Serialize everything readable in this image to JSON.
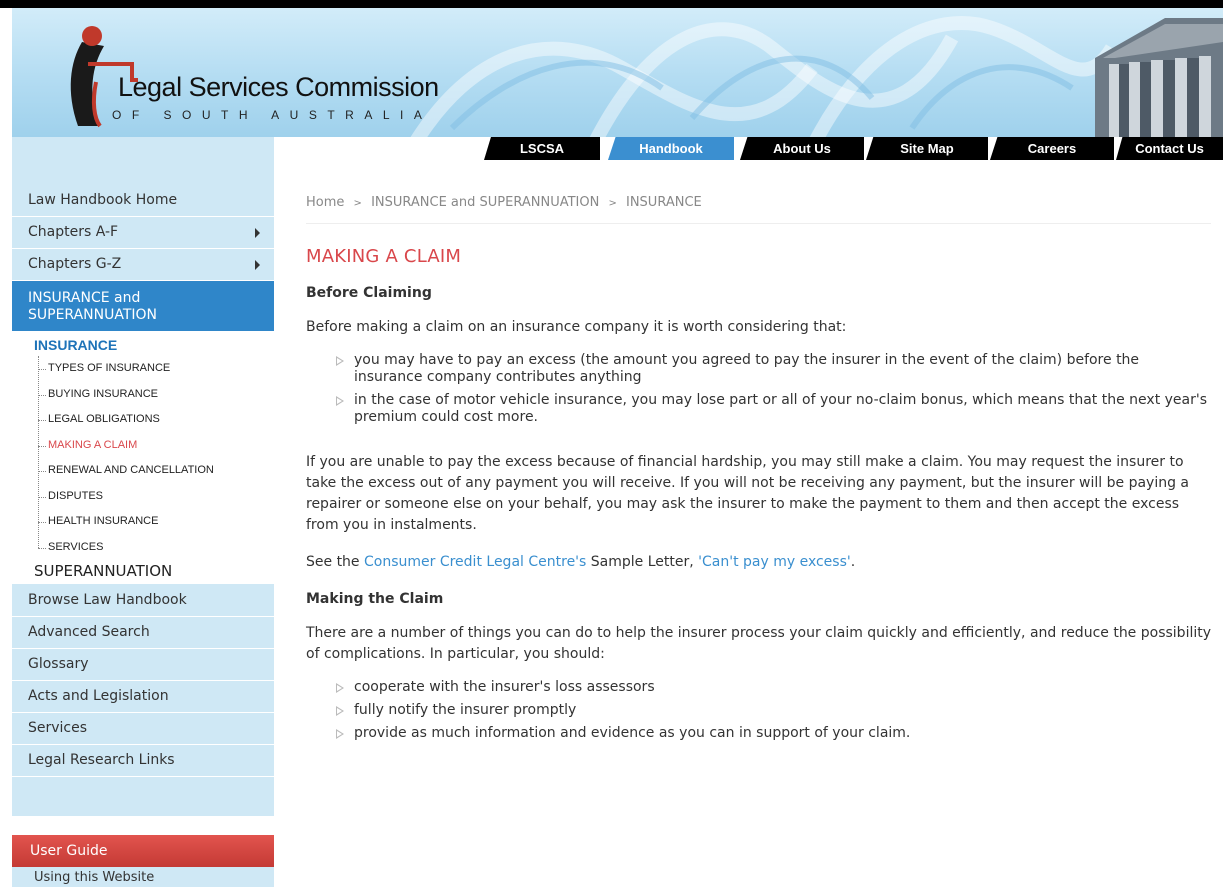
{
  "brand": {
    "title": "Legal Services Commission",
    "subtitle": "OF SOUTH AUSTRALIA"
  },
  "topnav": {
    "tabs": [
      {
        "label": "LSCSA",
        "active": false
      },
      {
        "label": "Handbook",
        "active": true
      },
      {
        "label": "About Us",
        "active": false
      },
      {
        "label": "Site Map",
        "active": false
      },
      {
        "label": "Careers",
        "active": false
      },
      {
        "label": "Contact Us",
        "active": false
      }
    ]
  },
  "sidebar": {
    "items_top": [
      "Law Handbook Home",
      "Chapters A-F",
      "Chapters G-Z"
    ],
    "active_section": "INSURANCE and SUPERANNUATION",
    "sub_heading": "INSURANCE",
    "sub_items": [
      "TYPES OF INSURANCE",
      "BUYING INSURANCE",
      "LEGAL OBLIGATIONS",
      "MAKING A CLAIM",
      "RENEWAL AND CANCELLATION",
      "DISPUTES",
      "HEALTH INSURANCE",
      "SERVICES"
    ],
    "current_sub_item": "MAKING A CLAIM",
    "superannuation": "SUPERANNUATION",
    "items_bottom": [
      "Browse Law Handbook",
      "Advanced Search",
      "Glossary",
      "Acts and Legislation",
      "Services",
      "Legal Research Links"
    ],
    "user_guide": "User Guide",
    "user_guide_item": "Using this Website"
  },
  "breadcrumb": {
    "home": "Home",
    "level1": "INSURANCE and SUPERANNUATION",
    "level2": "INSURANCE",
    "separator": ">"
  },
  "content": {
    "title": "MAKING A CLAIM",
    "section1_heading": "Before Claiming",
    "section1_intro": "Before making a claim on an insurance company it is worth considering that:",
    "section1_bullets": [
      "you may have to pay an excess (the amount you agreed to pay the insurer in the event of the claim) before the insurance company contributes anything",
      "in the case of motor vehicle insurance, you may lose part or all of your no-claim bonus, which means that the next year's premium could cost more."
    ],
    "hardship_para": "If you are unable to pay the excess because of financial hardship, you may still make a claim. You may request the insurer to take the excess out of any payment you will receive. If you will not be receiving any payment, but the insurer will be paying a repairer or someone else on your behalf, you may ask the insurer to make the payment to them and then accept the excess from you in instalments.",
    "see_prefix": "See the ",
    "see_link1": "Consumer Credit Legal Centre's",
    "see_middle": " Sample Letter, ",
    "see_link2": "'Can't pay my excess'",
    "see_suffix": ".",
    "section2_heading": "Making the Claim",
    "section2_intro": "There are a number of things you can do to help the insurer process your claim quickly and efficiently, and reduce the possibility of complications. In particular, you should:",
    "section2_bullets": [
      "cooperate with the insurer's loss assessors",
      "fully notify the insurer promptly",
      "provide as much information and evidence as you can in support of your claim."
    ]
  },
  "colors": {
    "active_tab": "#3b8fd0",
    "sidebar_bg": "#cfe8f5",
    "sidebar_active": "#2f86c9",
    "title_red": "#d9474b",
    "link_blue": "#3a8fcf",
    "user_guide_red": "#d2453f"
  }
}
